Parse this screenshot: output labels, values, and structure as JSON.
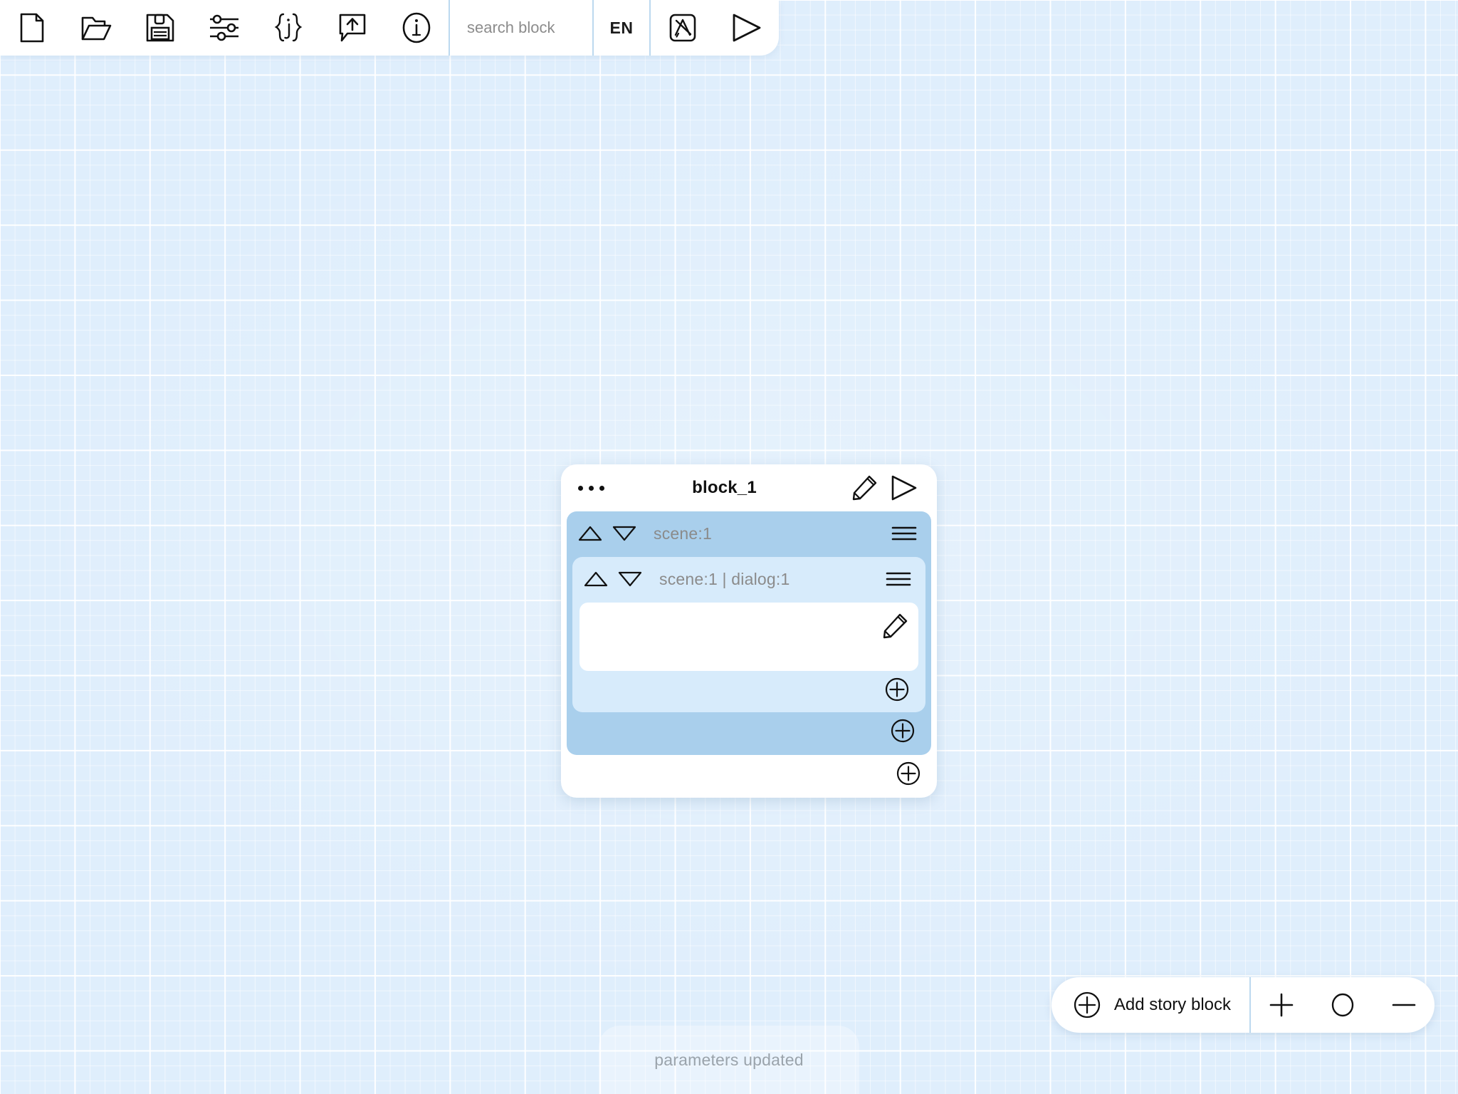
{
  "app": {
    "canvas_background": "#dfeefc",
    "grid_major_color": "#ffffff",
    "accent_blue": "#a9cfec",
    "accent_blue_light": "#d7ebfb",
    "separator_color": "#bcd9ef"
  },
  "toolbar": {
    "buttons": [
      {
        "name": "new-file",
        "icon": "file-icon"
      },
      {
        "name": "open-folder",
        "icon": "folder-open-icon"
      },
      {
        "name": "save",
        "icon": "floppy-disk-icon"
      },
      {
        "name": "settings",
        "icon": "sliders-icon"
      },
      {
        "name": "json",
        "icon": "json-braces-icon"
      },
      {
        "name": "export",
        "icon": "speech-bubble-up-arrow-icon"
      },
      {
        "name": "info",
        "icon": "info-circle-icon"
      }
    ],
    "search": {
      "placeholder": "search block",
      "value": ""
    },
    "language": {
      "label": "EN"
    },
    "right_buttons": [
      {
        "name": "translate",
        "icon": "translate-box-icon"
      },
      {
        "name": "play",
        "icon": "play-triangle-icon"
      }
    ]
  },
  "block_card": {
    "menu_icon": "ellipsis-icon",
    "title": "block_1",
    "edit_icon": "pencil-icon",
    "play_icon": "play-triangle-icon",
    "scene": {
      "label": "scene:1",
      "up_icon": "triangle-up-icon",
      "down_icon": "triangle-down-icon",
      "menu_icon": "hamburger-icon",
      "dialog": {
        "label": "scene:1 | dialog:1",
        "up_icon": "triangle-up-icon",
        "down_icon": "triangle-down-icon",
        "menu_icon": "hamburger-icon",
        "text_value": "",
        "text_edit_icon": "pencil-icon",
        "add_icon": "plus-circle-icon"
      },
      "add_icon": "plus-circle-icon"
    },
    "add_icon": "plus-circle-icon"
  },
  "bottom_bar": {
    "add_story_block": {
      "label": "Add story block",
      "icon": "plus-circle-icon"
    },
    "zoom_in": {
      "icon": "plus-icon"
    },
    "zoom_reset": {
      "icon": "circle-icon"
    },
    "zoom_out": {
      "icon": "minus-icon"
    }
  },
  "toast": {
    "message": "parameters updated"
  }
}
